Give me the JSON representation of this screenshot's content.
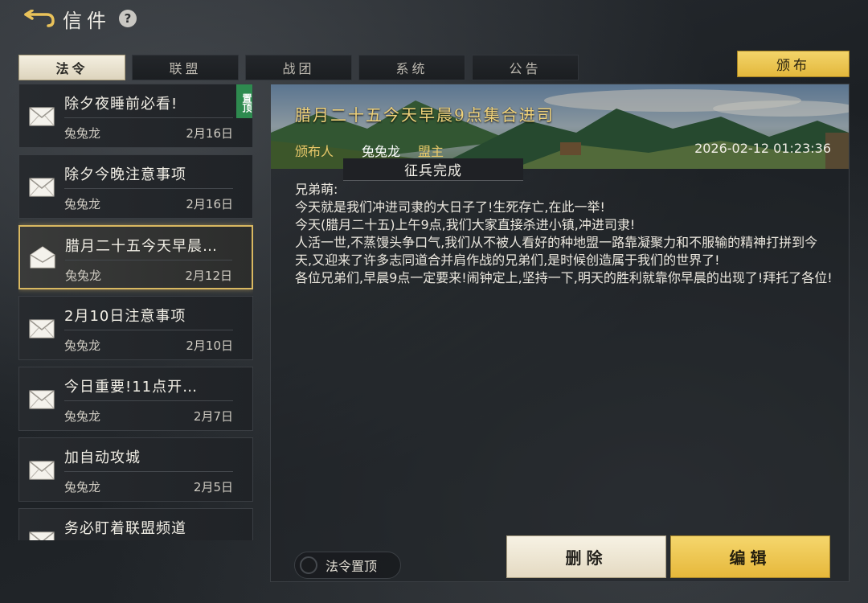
{
  "header": {
    "title": "信件",
    "help_label": "?"
  },
  "tabs": [
    {
      "label": "法令",
      "active": true
    },
    {
      "label": "联盟",
      "active": false
    },
    {
      "label": "战团",
      "active": false
    },
    {
      "label": "系统",
      "active": false
    },
    {
      "label": "公告",
      "active": false
    }
  ],
  "publish_button": "颁布",
  "mail_list": [
    {
      "subject": "除夕夜睡前必看!",
      "sender": "兔兔龙",
      "date": "2月16日",
      "pinned": true,
      "pin_label": "置顶",
      "opened": false
    },
    {
      "subject": "除夕今晚注意事项",
      "sender": "兔兔龙",
      "date": "2月16日",
      "pinned": false,
      "opened": false
    },
    {
      "subject": "腊月二十五今天早晨…",
      "sender": "兔兔龙",
      "date": "2月12日",
      "pinned": false,
      "opened": true,
      "selected": true
    },
    {
      "subject": "2月10日注意事项",
      "sender": "兔兔龙",
      "date": "2月10日",
      "pinned": false,
      "opened": false
    },
    {
      "subject": "今日重要!11点开…",
      "sender": "兔兔龙",
      "date": "2月7日",
      "pinned": false,
      "opened": false
    },
    {
      "subject": "加自动攻城",
      "sender": "兔兔龙",
      "date": "2月5日",
      "pinned": false,
      "opened": false
    },
    {
      "subject": "务必盯着联盟频道",
      "sender": "",
      "date": "",
      "pinned": false,
      "opened": false
    }
  ],
  "detail": {
    "subject": "腊月二十五今天早晨9点集合进司",
    "publisher_label": "颁布人",
    "publisher_name": "兔兔龙",
    "publisher_role": "盟主",
    "time": "2026-02-12 01:23:36",
    "status_tag": "征兵完成",
    "body": [
      "兄弟萌:",
      "今天就是我们冲进司隶的大日子了!生死存亡,在此一举!",
      "今天(腊月二十五)上午9点,我们大家直接杀进小镇,冲进司隶!",
      "人活一世,不蒸馒头争口气,我们从不被人看好的种地盟一路靠凝聚力和不服输的精神打拼到今天,又迎来了许多志同道合并肩作战的兄弟们,是时候创造属于我们的世界了!",
      "各位兄弟们,早晨9点一定要来!闹钟定上,坚持一下,明天的胜利就靠你早晨的出现了!拜托了各位!"
    ]
  },
  "pin_toggle_label": "法令置顶",
  "delete_button": "删除",
  "edit_button": "编辑",
  "colors": {
    "accent_gold": "#e3b83c",
    "pin_green": "#2e8a4f",
    "selected_border": "#d9b861"
  }
}
